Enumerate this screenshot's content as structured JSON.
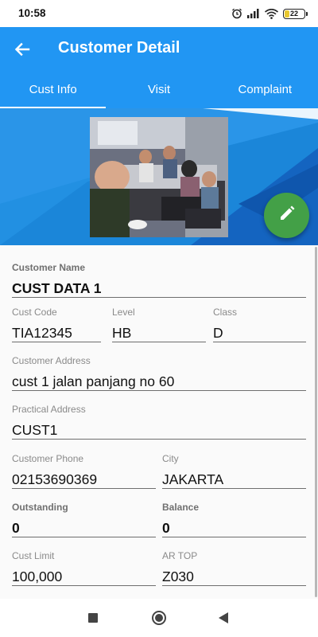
{
  "status": {
    "time": "10:58",
    "battery": "22",
    "battery_level": 0.22,
    "icons": [
      "alarm-icon",
      "signal-icon",
      "wifi-icon",
      "battery-icon"
    ]
  },
  "app_bar": {
    "title": "Customer Detail",
    "back_icon": "arrow-back-icon"
  },
  "tabs": [
    {
      "label": "Cust Info",
      "active": true
    },
    {
      "label": "Visit",
      "active": false
    },
    {
      "label": "Complaint",
      "active": false
    }
  ],
  "header": {
    "colors": {
      "dark_blue": "#1464c0",
      "mid_blue": "#1b86d9",
      "light_blue": "#3aa0f0"
    },
    "fab_icon": "pencil-edit-icon",
    "fab_color": "#43a047"
  },
  "form": {
    "customer_name": {
      "label": "Customer Name",
      "value": "CUST DATA 1"
    },
    "cust_code": {
      "label": "Cust Code",
      "value": "TIA12345"
    },
    "level": {
      "label": "Level",
      "value": "HB"
    },
    "class": {
      "label": "Class",
      "value": "D"
    },
    "customer_address": {
      "label": "Customer Address",
      "value": "cust 1 jalan panjang no 60"
    },
    "practical_address": {
      "label": "Practical Address",
      "value": "CUST1"
    },
    "customer_phone": {
      "label": "Customer Phone",
      "value": "02153690369"
    },
    "city": {
      "label": "City",
      "value": "JAKARTA"
    },
    "outstanding": {
      "label": "Outstanding",
      "value": "0"
    },
    "balance": {
      "label": "Balance",
      "value": "0"
    },
    "cust_limit": {
      "label": "Cust Limit",
      "value": "100,000"
    },
    "ar_top": {
      "label": "AR TOP",
      "value": "Z030"
    }
  },
  "nav": {
    "icons": [
      "recent-apps-icon",
      "home-icon",
      "back-icon"
    ]
  },
  "colors": {
    "primary": "#2196f3",
    "accent_green": "#43a047"
  }
}
